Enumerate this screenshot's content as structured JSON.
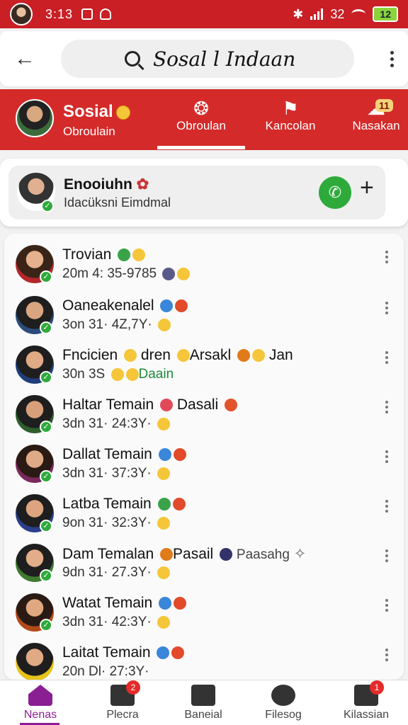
{
  "status_bar": {
    "time": "3:13",
    "signal_text": "32",
    "battery": "12"
  },
  "search": {
    "value": "Sosal l Indaan"
  },
  "tabs": {
    "profile_title": "Sosial",
    "profile_sub": "Obroulain",
    "items": [
      {
        "label": "Obroulan"
      },
      {
        "label": "Kancolan"
      },
      {
        "label": "Nasakan",
        "badge": "11"
      }
    ]
  },
  "pinned": {
    "name": "Enooiuhn",
    "subtitle": "Idacüksni Eimdmal"
  },
  "chats": [
    {
      "name": "Trovian",
      "meta": "20m 4: 35-9785",
      "avatar_color": "#b3262a"
    },
    {
      "name": "Oaneakenalel",
      "meta": "3on 31· 4Z,7Y·",
      "avatar_color": "#2b4b7a"
    },
    {
      "name": "Fncicien",
      "name_extra": "dren",
      "name_extra2": "Arsakl",
      "name_tail": "Jan",
      "meta": "30n 3S",
      "meta_green": "Daain",
      "avatar_color": "#1f3e7a"
    },
    {
      "name": "Haltar Temain",
      "name_extra": "Dasali",
      "meta": "3dn 31· 24:3Y·",
      "avatar_color": "#2d5e2d"
    },
    {
      "name": "Dallat Temain",
      "meta": "3dn 31· 37:3Y·",
      "avatar_color": "#7a2a5a"
    },
    {
      "name": "Latba Temain",
      "meta": "9on 31· 32:3Y·",
      "avatar_color": "#2a3f8a"
    },
    {
      "name": "Dam Temalan",
      "name_extra": "Pasail",
      "name_tail": "Paasahg",
      "meta": "9dn 31· 27.3Y·",
      "avatar_color": "#3d7a2d"
    },
    {
      "name": "Watat Temain",
      "meta": "3dn 31· 42:3Y·",
      "avatar_color": "#b34a1a"
    },
    {
      "name": "Laitat Temain",
      "meta": "20n Dl· 27:3Y·",
      "avatar_color": "#e6c21a"
    }
  ],
  "bottom_nav": [
    {
      "label": "Nenas",
      "icon": "home-icon",
      "active": true
    },
    {
      "label": "Plecra",
      "icon": "mail-icon",
      "badge": "2"
    },
    {
      "label": "Baneial",
      "icon": "layers-icon"
    },
    {
      "label": "Filesog",
      "icon": "camera-icon"
    },
    {
      "label": "Kilassian",
      "icon": "tools-icon",
      "badge": "1"
    }
  ]
}
